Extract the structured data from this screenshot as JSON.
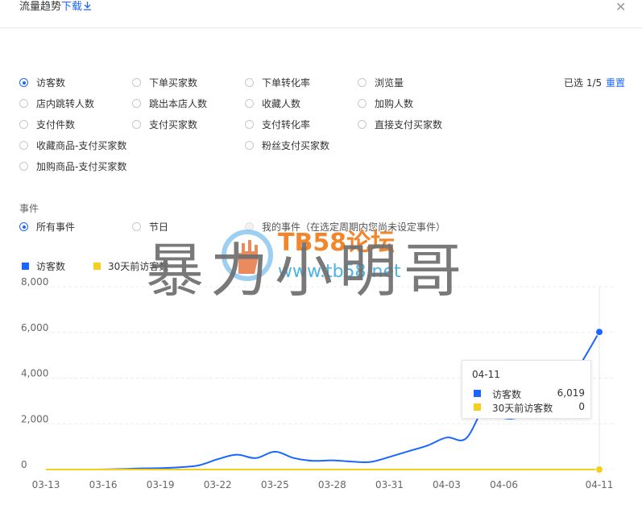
{
  "header": {
    "title": "流量趋势",
    "download_label": "下载",
    "download_icon": "download-icon",
    "close_icon": "close-icon"
  },
  "metrics": {
    "options": [
      {
        "label": "访客数",
        "selected": true
      },
      {
        "label": "下单买家数",
        "selected": false
      },
      {
        "label": "下单转化率",
        "selected": false
      },
      {
        "label": "浏览量",
        "selected": false
      },
      {
        "label": "店内跳转人数",
        "selected": false
      },
      {
        "label": "跳出本店人数",
        "selected": false
      },
      {
        "label": "收藏人数",
        "selected": false
      },
      {
        "label": "加购人数",
        "selected": false
      },
      {
        "label": "支付件数",
        "selected": false
      },
      {
        "label": "支付买家数",
        "selected": false
      },
      {
        "label": "支付转化率",
        "selected": false
      },
      {
        "label": "直接支付买家数",
        "selected": false
      },
      {
        "label": "收藏商品-支付买家数",
        "selected": false
      },
      {
        "label": "粉丝支付买家数",
        "selected": false
      },
      {
        "label": "加购商品-支付买家数",
        "selected": false
      }
    ],
    "selected_count": "已选 1/5",
    "reset_label": "重置"
  },
  "events": {
    "label": "事件",
    "options": [
      {
        "label": "所有事件",
        "selected": true,
        "disabled": false
      },
      {
        "label": "节日",
        "selected": false,
        "disabled": false
      },
      {
        "label": "我的事件（在选定周期内您尚未设定事件）",
        "selected": false,
        "disabled": true
      }
    ]
  },
  "watermark": {
    "text": "暴力小明哥",
    "brand": "TB58论坛",
    "url": "www.tb58.net"
  },
  "chart_data": {
    "type": "line",
    "x": [
      "03-13",
      "03-14",
      "03-15",
      "03-16",
      "03-17",
      "03-18",
      "03-19",
      "03-20",
      "03-21",
      "03-22",
      "03-23",
      "03-24",
      "03-25",
      "03-26",
      "03-27",
      "03-28",
      "03-29",
      "03-30",
      "03-31",
      "04-01",
      "04-02",
      "04-03",
      "04-04",
      "04-05",
      "04-06",
      "04-07",
      "04-08",
      "04-09",
      "04-10",
      "04-11"
    ],
    "x_tick_labels": [
      "03-13",
      "03-16",
      "03-19",
      "03-22",
      "03-25",
      "03-28",
      "03-31",
      "04-03",
      "04-06",
      "04-11"
    ],
    "series": [
      {
        "name": "访客数",
        "color": "#1a66ff",
        "values": [
          0,
          0,
          0,
          5,
          20,
          50,
          60,
          100,
          180,
          450,
          650,
          500,
          780,
          500,
          380,
          400,
          350,
          330,
          550,
          800,
          1050,
          1400,
          1350,
          2650,
          2250,
          2350,
          2900,
          3400,
          4600,
          6019
        ]
      },
      {
        "name": "30天前访客数",
        "color": "#f5ce1e",
        "values": [
          0,
          0,
          0,
          0,
          0,
          0,
          0,
          0,
          0,
          0,
          0,
          0,
          0,
          0,
          0,
          0,
          0,
          0,
          0,
          0,
          0,
          0,
          0,
          0,
          0,
          0,
          0,
          0,
          0,
          0
        ]
      }
    ],
    "yticks": [
      "0",
      "2,000",
      "4,000",
      "6,000",
      "8,000"
    ],
    "ylim": [
      0,
      8000
    ],
    "grid": true,
    "legend": "top-left",
    "tooltip": {
      "date": "04-11",
      "rows": [
        {
          "name": "访客数",
          "value": "6,019"
        },
        {
          "name": "30天前访客数",
          "value": "0"
        }
      ]
    }
  }
}
